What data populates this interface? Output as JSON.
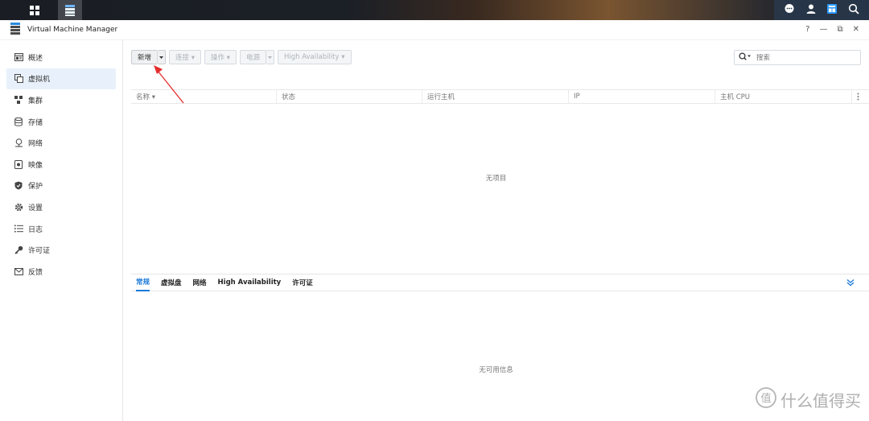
{
  "app": {
    "title": "Virtual Machine Manager"
  },
  "window_controls": {
    "help": "?",
    "minimize": "—",
    "restore": "⧉",
    "close": "✕"
  },
  "sidebar": {
    "items": [
      {
        "label": "概述",
        "icon": "overview-icon"
      },
      {
        "label": "虚拟机",
        "icon": "vm-icon",
        "active": true
      },
      {
        "label": "集群",
        "icon": "cluster-icon"
      },
      {
        "label": "存储",
        "icon": "storage-icon"
      },
      {
        "label": "网络",
        "icon": "network-icon"
      },
      {
        "label": "映像",
        "icon": "image-icon"
      },
      {
        "label": "保护",
        "icon": "shield-icon"
      },
      {
        "label": "设置",
        "icon": "gear-icon"
      },
      {
        "label": "日志",
        "icon": "log-icon"
      },
      {
        "label": "许可证",
        "icon": "key-icon"
      },
      {
        "label": "反馈",
        "icon": "mail-icon"
      }
    ]
  },
  "toolbar": {
    "create": "新增",
    "connect": "连接 ▾",
    "action": "操作 ▾",
    "power": "电源",
    "ha": "High Availability ▾"
  },
  "search": {
    "placeholder": "搜索"
  },
  "table": {
    "columns": [
      "名称 ▾",
      "状态",
      "运行主机",
      "IP",
      "主机 CPU"
    ],
    "empty_text": "无项目"
  },
  "detail_tabs": [
    "常规",
    "虚拟盘",
    "网络",
    "High Availability",
    "许可证"
  ],
  "detail": {
    "empty_text": "无可用信息"
  },
  "watermark": {
    "text": "什么值得买",
    "logo": "值"
  },
  "colors": {
    "accent": "#1d7ad8",
    "arrow": "#e52d2d",
    "active_nav_bg": "#e8f1fb"
  }
}
